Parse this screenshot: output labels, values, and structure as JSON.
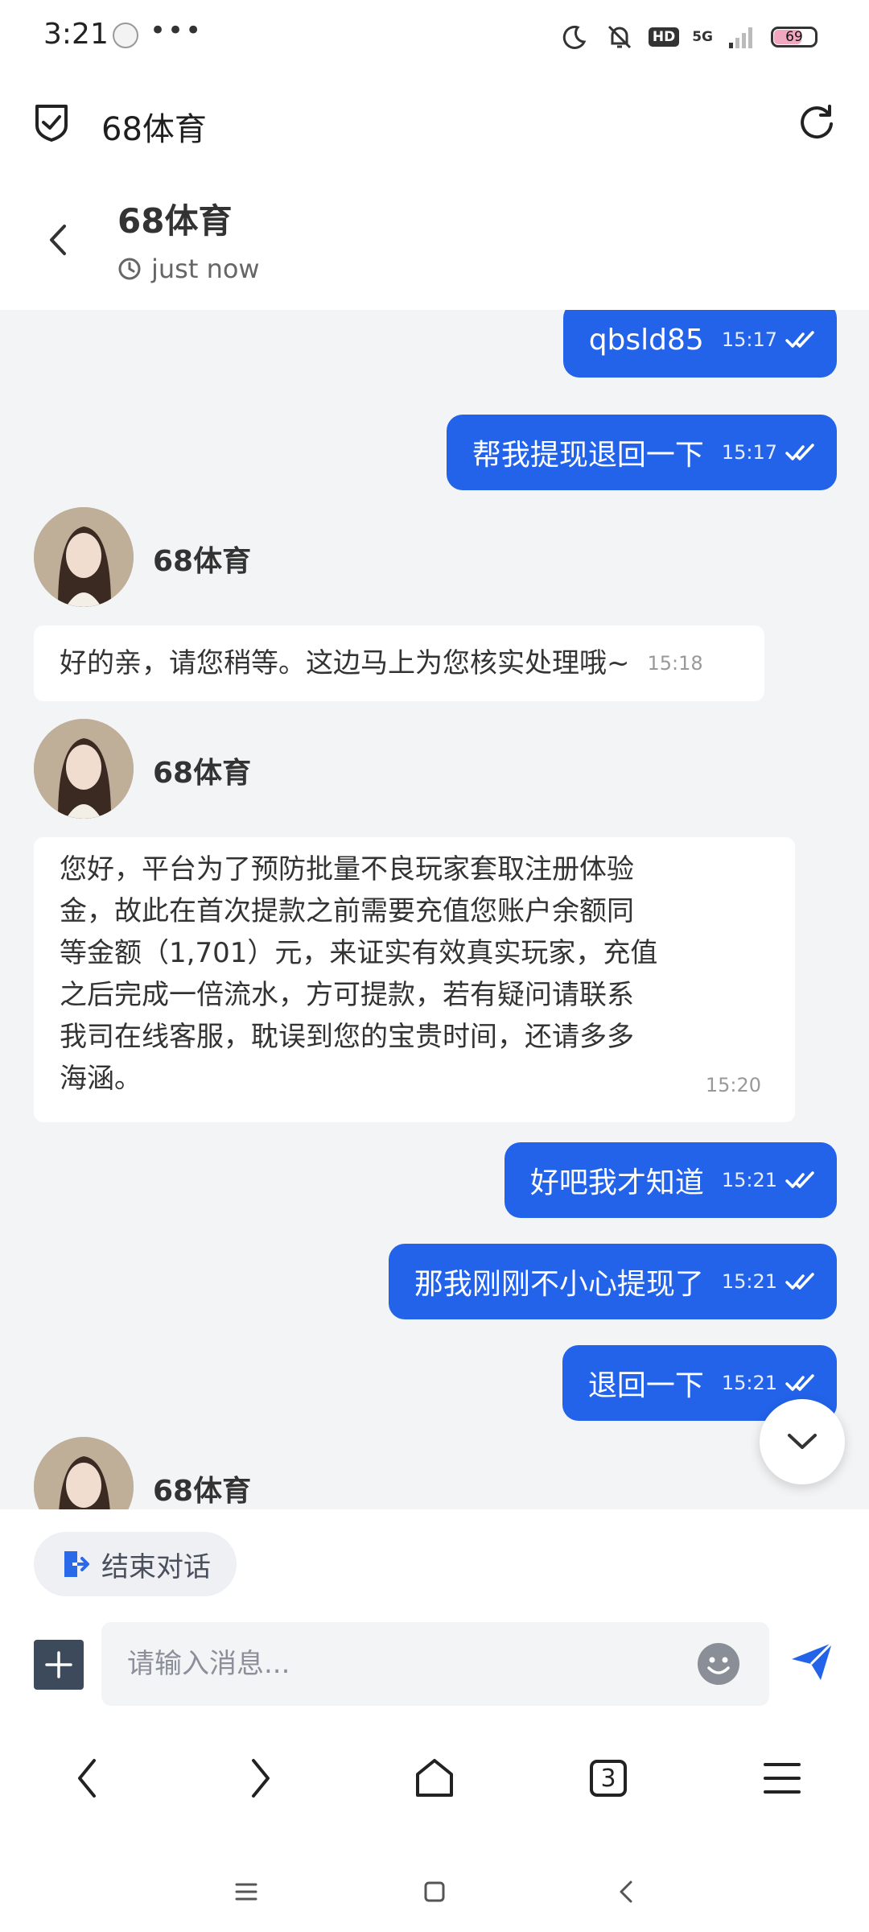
{
  "status_bar": {
    "time": "3:21",
    "dots": "•••",
    "network": "5G",
    "hd": "HD",
    "battery": "69"
  },
  "browser": {
    "title": "68体育",
    "tab_count": "3"
  },
  "chat_header": {
    "title": "68体育",
    "status": "just now"
  },
  "messages": [
    {
      "dir": "out",
      "text": "qbsld85",
      "time": "15:17"
    },
    {
      "dir": "out",
      "text": "帮我提现退回一下",
      "time": "15:17"
    },
    {
      "dir": "in",
      "sender": "68体育",
      "text": "好的亲，请您稍等。这边马上为您核实处理哦~",
      "time": "15:18"
    },
    {
      "dir": "in",
      "sender": "68体育",
      "lines": [
        "您好，平台为了预防批量不良玩家套取注册体验",
        "金，故此在首次提款之前需要充值您账户余额同",
        "等金额（1,701）元，来证实有效真实玩家，充值",
        "之后完成一倍流水，方可提款，若有疑问请联系",
        "我司在线客服，耽误到您的宝贵时间，还请多多",
        "海涵。"
      ],
      "time": "15:20"
    },
    {
      "dir": "out",
      "text": "好吧我才知道",
      "time": "15:21"
    },
    {
      "dir": "out",
      "text": "那我刚刚不小心提现了",
      "time": "15:21"
    },
    {
      "dir": "out",
      "text": "退回一下",
      "time": "15:21"
    },
    {
      "dir": "in",
      "sender": "68体育"
    }
  ],
  "input": {
    "end_chat_label": "结束对话",
    "placeholder": "请输入消息..."
  },
  "colors": {
    "accent": "#2263ea",
    "chat_bg": "#f3f4f6",
    "bubble_in": "#ffffff"
  }
}
